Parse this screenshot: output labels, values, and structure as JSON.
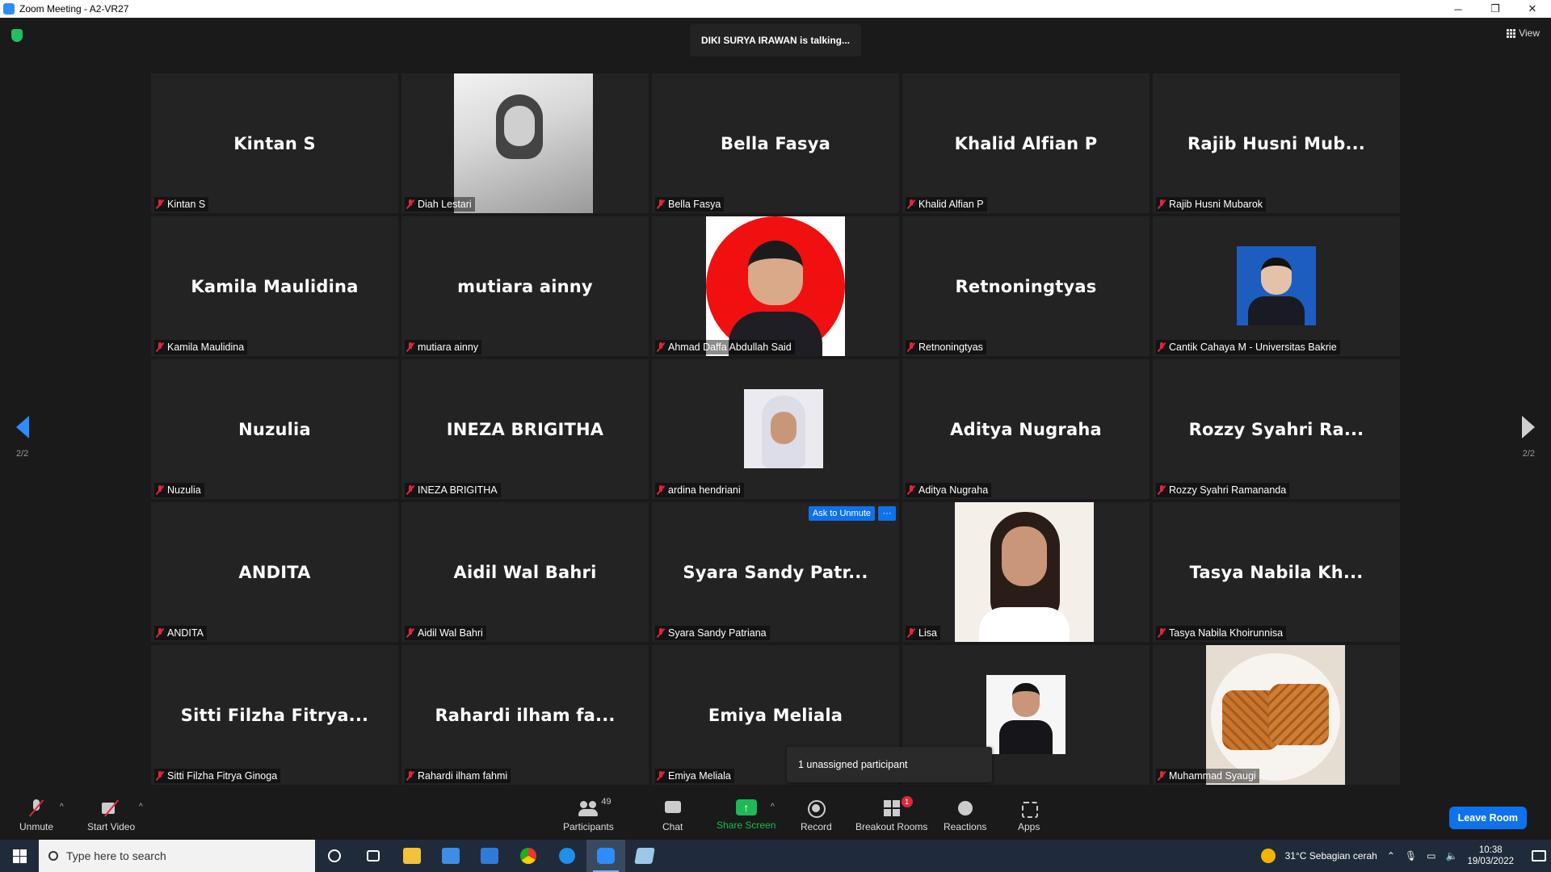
{
  "window": {
    "title": "Zoom Meeting - A2-VR27",
    "minimize": "─",
    "restore": "❐",
    "close": "✕"
  },
  "meeting": {
    "talking": "DIKI SURYA IRAWAN is talking...",
    "view_label": "View",
    "page_indicator_left": "2/2",
    "page_indicator_right": "2/2",
    "ask_to_unmute": "Ask to Unmute",
    "more": "···",
    "tooltip": "1 unassigned participant"
  },
  "tiles": [
    {
      "big": "Kintan S",
      "label": "Kintan S",
      "photo": ""
    },
    {
      "big": "",
      "label": "Diah Lestari",
      "photo": "bw-selfie"
    },
    {
      "big": "Bella Fasya",
      "label": "Bella Fasya",
      "photo": ""
    },
    {
      "big": "Khalid Alfian P",
      "label": "Khalid Alfian P",
      "photo": ""
    },
    {
      "big": "Rajib Husni Mub...",
      "label": "Rajib Husni Mubarok",
      "photo": ""
    },
    {
      "big": "Kamila Maulidina",
      "label": "Kamila Maulidina",
      "photo": ""
    },
    {
      "big": "mutiara ainny",
      "label": "mutiara ainny",
      "photo": ""
    },
    {
      "big": "",
      "label": "Ahmad Daffa Abdullah Said",
      "photo": "red-portrait"
    },
    {
      "big": "Retnoningtyas",
      "label": "Retnoningtyas",
      "photo": ""
    },
    {
      "big": "",
      "label": "Cantik Cahaya M - Universitas Bakrie",
      "photo": "blue-portrait"
    },
    {
      "big": "Nuzulia",
      "label": "Nuzulia",
      "photo": ""
    },
    {
      "big": "INEZA BRIGITHA",
      "label": "INEZA BRIGITHA",
      "photo": ""
    },
    {
      "big": "",
      "label": "ardina hendriani",
      "photo": "hijab-portrait"
    },
    {
      "big": "Aditya Nugraha",
      "label": "Aditya Nugraha",
      "photo": ""
    },
    {
      "big": "Rozzy Syahri Ra...",
      "label": "Rozzy Syahri Ramananda",
      "photo": ""
    },
    {
      "big": "ANDITA",
      "label": "ANDITA",
      "photo": ""
    },
    {
      "big": "Aidil Wal Bahri",
      "label": "Aidil Wal Bahri",
      "photo": ""
    },
    {
      "big": "Syara Sandy Patr...",
      "label": "Syara Sandy Patriana",
      "photo": ""
    },
    {
      "big": "",
      "label": "Lisa",
      "photo": "lisa-portrait"
    },
    {
      "big": "Tasya Nabila Kh...",
      "label": "Tasya Nabila Khoirunnisa",
      "photo": ""
    },
    {
      "big": "Sitti Filzha Fitrya...",
      "label": "Sitti Filzha Fitrya Ginoga",
      "photo": ""
    },
    {
      "big": "Rahardi ilham fa...",
      "label": "Rahardi ilham fahmi",
      "photo": ""
    },
    {
      "big": "Emiya Meliala",
      "label": "Emiya Meliala",
      "photo": ""
    },
    {
      "big": "",
      "label": "",
      "photo": "suit-portrait"
    },
    {
      "big": "",
      "label": "Muhammad Syaugi",
      "photo": "waffle"
    }
  ],
  "toolbar": {
    "unmute": "Unmute",
    "start_video": "Start Video",
    "participants": "Participants",
    "participants_count": "49",
    "chat": "Chat",
    "share_screen": "Share Screen",
    "record": "Record",
    "breakout_rooms": "Breakout Rooms",
    "breakout_badge": "1",
    "reactions": "Reactions",
    "apps": "Apps",
    "leave": "Leave Room",
    "caret": "^"
  },
  "taskbar": {
    "search_placeholder": "Type here to search",
    "weather": "31°C  Sebagian cerah",
    "time": "10:38",
    "date": "19/03/2022"
  },
  "colors": {
    "accent": "#0e72ed",
    "share": "#1db954",
    "muted": "#e0263b",
    "tile_bg": "#232323"
  }
}
